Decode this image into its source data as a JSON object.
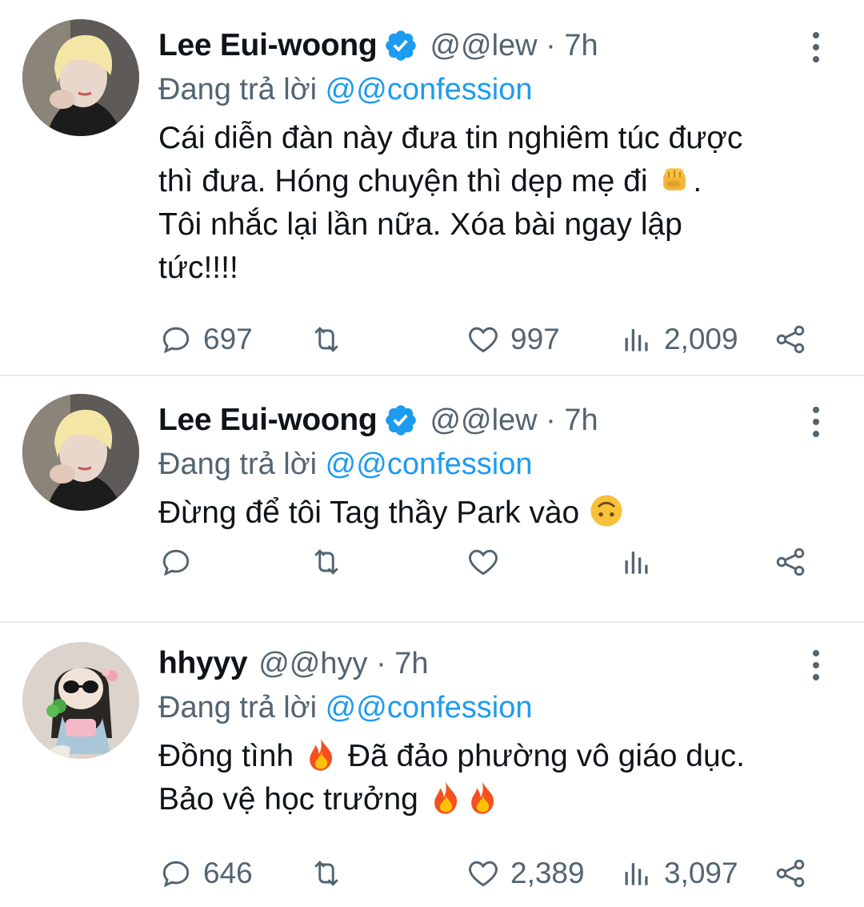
{
  "tweets": [
    {
      "name": "Lee Eui-woong",
      "verified": true,
      "handle": "@@lew",
      "time": "7h",
      "replying_prefix": "Đang trả lời",
      "replying_to": "@@confession",
      "body_lines": [
        "Cái diễn đàn này đưa tin nghiêm túc được",
        "thì đưa. Hóng chuyện thì dẹp mẹ đi",
        "Tôi nhắc lại lần nữa. Xóa bài ngay lập",
        "tức!!!!"
      ],
      "replies": "697",
      "likes": "997",
      "views": "2,009"
    },
    {
      "name": "Lee Eui-woong",
      "verified": true,
      "handle": "@@lew",
      "time": "7h",
      "replying_prefix": "Đang trả lời",
      "replying_to": "@@confession",
      "body_lines": [
        "Đừng để tôi Tag thầy Park vào"
      ],
      "replies": "",
      "likes": "",
      "views": ""
    },
    {
      "name": "hhyyy",
      "verified": false,
      "handle": "@@hyy",
      "time": "7h",
      "replying_prefix": "Đang trả lời",
      "replying_to": "@@confession",
      "body_lines": [
        "Đồng tình",
        "Đã đảo phường vô giáo dục.",
        "Bảo vệ học trưởng"
      ],
      "replies": "646",
      "likes": "2,389",
      "views": "3,097"
    }
  ],
  "icons": {
    "reply": "reply-icon",
    "retweet": "retweet-icon",
    "like": "heart-icon",
    "views": "views-icon",
    "share": "share-icon",
    "more": "more-options-icon",
    "verified": "verified-badge-icon"
  },
  "colors": {
    "accent": "#1d9bf0",
    "secondary_text": "#536471",
    "primary_text": "#0f1419",
    "divider": "#e6e9eb"
  }
}
